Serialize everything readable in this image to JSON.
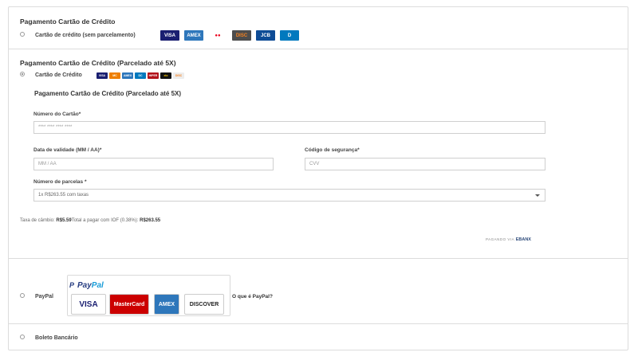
{
  "cc_simple": {
    "title": "Pagamento Cartão de Crédito",
    "option_label": "Cartão de crédito (sem parcelamento)",
    "cards": [
      {
        "name": "visa",
        "text": "VISA",
        "bg": "#1a1f71",
        "fg": "#ffffff"
      },
      {
        "name": "amex",
        "text": "AMEX",
        "bg": "#2e77bb",
        "fg": "#ffffff"
      },
      {
        "name": "mastercard",
        "text": "●●",
        "bg": "#ffffff",
        "fg": "#eb001b"
      },
      {
        "name": "discover",
        "text": "DISC",
        "bg": "#4d4d4d",
        "fg": "#f58220"
      },
      {
        "name": "jcb",
        "text": "JCB",
        "bg": "#0e4c96",
        "fg": "#ffffff"
      },
      {
        "name": "diners",
        "text": "D",
        "bg": "#0079be",
        "fg": "#ffffff"
      }
    ]
  },
  "cc_installment": {
    "title": "Pagamento Cartão de Crédito (Parcelado até 5X)",
    "option_label": "Cartão de Crédito",
    "cards": [
      {
        "name": "visa",
        "text": "VISA",
        "bg": "#1a1f71",
        "fg": "#ffffff"
      },
      {
        "name": "mastercard",
        "text": "MC",
        "bg": "#ee7f00",
        "fg": "#ffffff"
      },
      {
        "name": "amex",
        "text": "AMEX",
        "bg": "#2e77bb",
        "fg": "#ffffff"
      },
      {
        "name": "diners",
        "text": "DC",
        "bg": "#0079be",
        "fg": "#ffffff"
      },
      {
        "name": "hipercard",
        "text": "HIPER",
        "bg": "#b3131b",
        "fg": "#ffffff"
      },
      {
        "name": "elo",
        "text": "elo",
        "bg": "#111111",
        "fg": "#ffcb05"
      },
      {
        "name": "discover",
        "text": "DISC",
        "bg": "#ededed",
        "fg": "#f58220"
      }
    ],
    "form_title": "Pagamento Cartão de Crédito (Parcelado até 5X)",
    "card_number": {
      "label": "Número do Cartão*",
      "placeholder": "**** **** **** ****"
    },
    "expiry": {
      "label": "Data de validade (MM / AA)*",
      "placeholder": "MM / AA"
    },
    "cvv": {
      "label": "Código de segurança*",
      "placeholder": "CVV"
    },
    "installments": {
      "label": "Número de parcelas *",
      "value": "1x R$263.55 com taxas"
    },
    "exchange": {
      "label": "Taxa de câmbio:",
      "rate": "R$5.59",
      "total_label": "Total a pagar com IOF (0.38%):",
      "total": "R$263.55"
    },
    "paying_via": {
      "label": "PAGANDO VIA",
      "brand": "EBANX"
    }
  },
  "paypal": {
    "option_label": "PayPal",
    "logo_pay": "Pay",
    "logo_pal": "Pal",
    "logo_p": "P",
    "cards": [
      {
        "name": "visa",
        "text": "VISA",
        "bg": "#ffffff",
        "fg": "#1a1f71"
      },
      {
        "name": "mastercard",
        "text": "MasterCard",
        "bg": "#cc0000",
        "fg": "#ffffff"
      },
      {
        "name": "amex",
        "text": "AMEX",
        "bg": "#2e77bb",
        "fg": "#ffffff"
      },
      {
        "name": "discover",
        "text": "DISCOVER",
        "bg": "#ffffff",
        "fg": "#222222"
      }
    ],
    "info_link": "O que é PayPal?"
  },
  "boleto": {
    "option_label": "Boleto Bancário"
  }
}
